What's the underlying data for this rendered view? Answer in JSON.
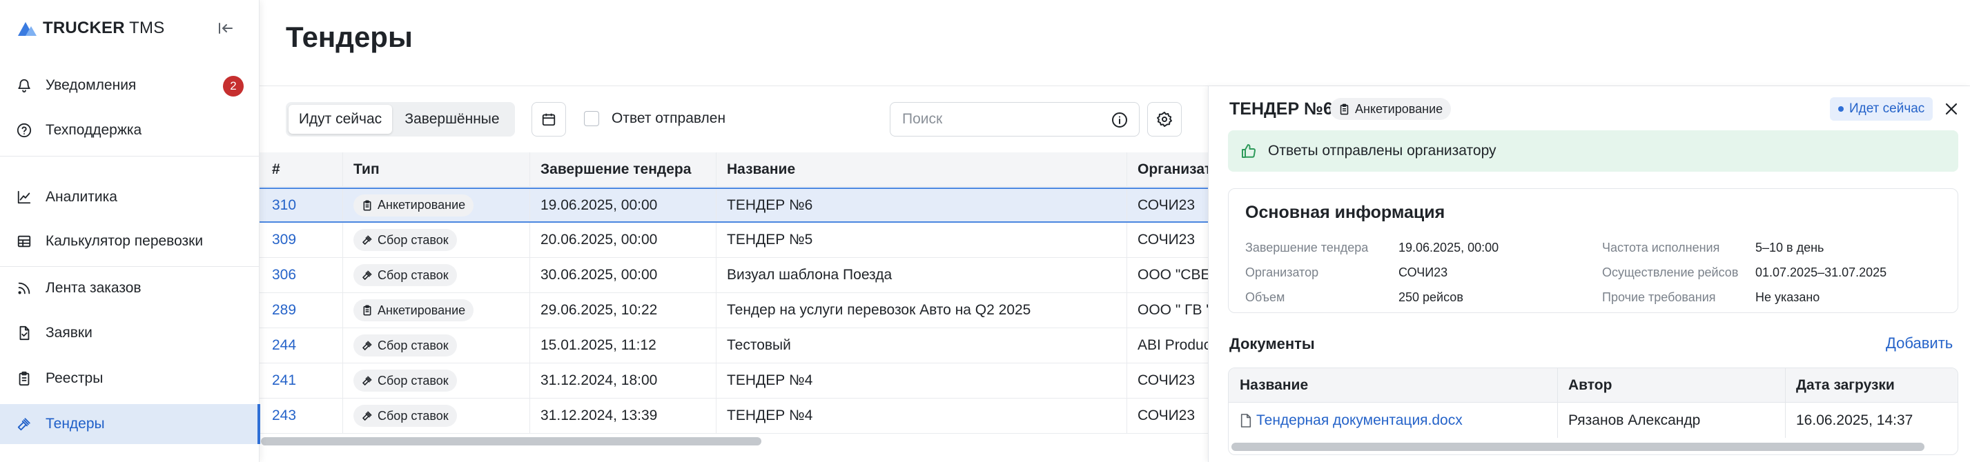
{
  "brand": {
    "name_bold": "TRUCKER",
    "name_rest": " TMS"
  },
  "sidebar": {
    "items": [
      {
        "key": "notifications",
        "label": "Уведомления",
        "icon": "bell-icon",
        "badge": "2"
      },
      {
        "key": "support",
        "label": "Техподдержка",
        "icon": "help-circle-icon"
      },
      {
        "key": "analytics",
        "label": "Аналитика",
        "icon": "chart-line-icon"
      },
      {
        "key": "calculator",
        "label": "Калькулятор перевозки",
        "icon": "table-icon"
      },
      {
        "key": "orders-feed",
        "label": "Лента заказов",
        "icon": "feed-icon"
      },
      {
        "key": "requests",
        "label": "Заявки",
        "icon": "document-icon"
      },
      {
        "key": "registries",
        "label": "Реестры",
        "icon": "clipboard-icon"
      },
      {
        "key": "tenders",
        "label": "Тендеры",
        "icon": "gavel-icon",
        "active": true
      }
    ]
  },
  "page": {
    "title": "Тендеры"
  },
  "toolbar": {
    "tab_current": "Идут сейчас",
    "tab_finished": "Завершённые",
    "answer_sent_label": "Ответ отправлен",
    "search_placeholder": "Поиск"
  },
  "table": {
    "columns": [
      "#",
      "Тип",
      "Завершение тендера",
      "Название",
      "Организатор"
    ],
    "rows": [
      {
        "id": "310",
        "type": "Анкетирование",
        "type_icon": "clipboard-icon",
        "end": "19.06.2025, 00:00",
        "name": "ТЕНДЕР №6",
        "org": "СОЧИ23",
        "selected": true
      },
      {
        "id": "309",
        "type": "Сбор ставок",
        "type_icon": "gavel-icon",
        "end": "20.06.2025, 00:00",
        "name": "ТЕНДЕР №5",
        "org": "СОЧИ23"
      },
      {
        "id": "306",
        "type": "Сбор ставок",
        "type_icon": "gavel-icon",
        "end": "30.06.2025, 00:00",
        "name": "Визуал шаблона Поезда",
        "org": "ООО \"СВЕЗ"
      },
      {
        "id": "289",
        "type": "Анкетирование",
        "type_icon": "clipboard-icon",
        "end": "29.06.2025, 10:22",
        "name": "Тендер на услуги перевозок Авто на Q2 2025",
        "org": "ООО \" ГВ \""
      },
      {
        "id": "244",
        "type": "Сбор ставок",
        "type_icon": "gavel-icon",
        "end": "15.01.2025, 11:12",
        "name": "Тестовый",
        "org": "ABI Produc"
      },
      {
        "id": "241",
        "type": "Сбор ставок",
        "type_icon": "gavel-icon",
        "end": "31.12.2024, 18:00",
        "name": "ТЕНДЕР №4",
        "org": "СОЧИ23"
      },
      {
        "id": "243",
        "type": "Сбор ставок",
        "type_icon": "gavel-icon",
        "end": "31.12.2024, 13:39",
        "name": "ТЕНДЕР №4",
        "org": "СОЧИ23"
      }
    ]
  },
  "panel": {
    "title": "ТЕНДЕР №6",
    "type": "Анкетирование",
    "status": "Идет сейчас",
    "alert": "Ответы отправлены организатору",
    "info": {
      "title": "Основная информация",
      "left": [
        {
          "label": "Завершение тендера",
          "value": "19.06.2025, 00:00"
        },
        {
          "label": "Организатор",
          "value": "СОЧИ23"
        },
        {
          "label": "Объем",
          "value": "250 рейсов"
        }
      ],
      "right": [
        {
          "label": "Частота исполнения",
          "value": "5–10 в день"
        },
        {
          "label": "Осуществление рейсов",
          "value": "01.07.2025–31.07.2025"
        },
        {
          "label": "Прочие требования",
          "value": "Не указано"
        }
      ]
    },
    "documents": {
      "title": "Документы",
      "add_label": "Добавить",
      "columns": [
        "Название",
        "Автор",
        "Дата загрузки"
      ],
      "rows": [
        {
          "name": "Тендерная документация.docx",
          "author": "Рязанов Александр",
          "date": "16.06.2025, 14:37"
        }
      ]
    }
  },
  "colors": {
    "accent": "#2f6fd6",
    "badge": "#c62f2f",
    "active_bg": "#dfe9f7",
    "success_bg": "#e5f5ec"
  }
}
